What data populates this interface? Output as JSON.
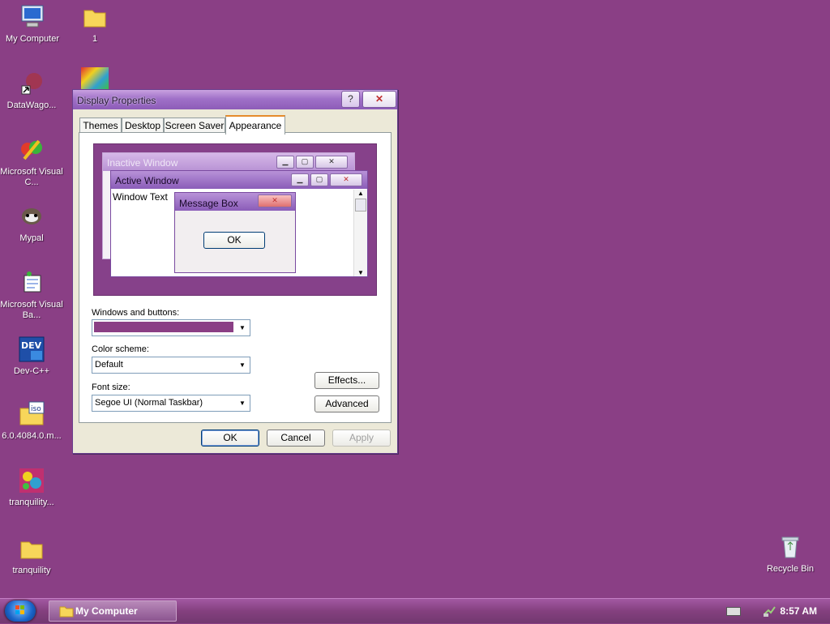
{
  "desktop": {
    "icons": [
      {
        "label": "My Computer",
        "icon": "computer-icon"
      },
      {
        "label": "1",
        "icon": "folder-icon"
      },
      {
        "label": "DataWago...",
        "icon": "shortcut-icon"
      },
      {
        "label": "Microsoft Visual C...",
        "icon": "visual-studio-icon"
      },
      {
        "label": "Mypal",
        "icon": "mypal-icon"
      },
      {
        "label": "Microsoft Visual Ba...",
        "icon": "visual-basic-icon"
      },
      {
        "label": "Dev-C++",
        "icon": "dev-cpp-icon"
      },
      {
        "label": "6.0.4084.0.m...",
        "icon": "iso-folder-icon"
      },
      {
        "label": "tranquility...",
        "icon": "image-icon"
      },
      {
        "label": "tranquility",
        "icon": "folder-icon"
      },
      {
        "label": "Recycle Bin",
        "icon": "recycle-bin-icon"
      }
    ]
  },
  "dialog": {
    "title": "Display Properties",
    "help_label": "?",
    "close_label": "✕",
    "tabs": [
      {
        "label": "Themes"
      },
      {
        "label": "Desktop"
      },
      {
        "label": "Screen Saver"
      },
      {
        "label": "Appearance"
      }
    ],
    "preview": {
      "inactive_title": "Inactive Window",
      "active_title": "Active Window",
      "window_text": "Window Text",
      "message_title": "Message Box",
      "ok_label": "OK"
    },
    "windows_buttons_label": "Windows and buttons:",
    "windows_buttons_swatch": "#8a3f85",
    "color_scheme_label": "Color scheme:",
    "color_scheme_value": "Default",
    "font_size_label": "Font size:",
    "font_size_value": "Segoe UI (Normal Taskbar)",
    "effects_label": "Effects...",
    "advanced_label": "Advanced",
    "ok_label": "OK",
    "cancel_label": "Cancel",
    "apply_label": "Apply"
  },
  "taskbar": {
    "task_label": "My Computer",
    "clock": "8:57 AM"
  }
}
